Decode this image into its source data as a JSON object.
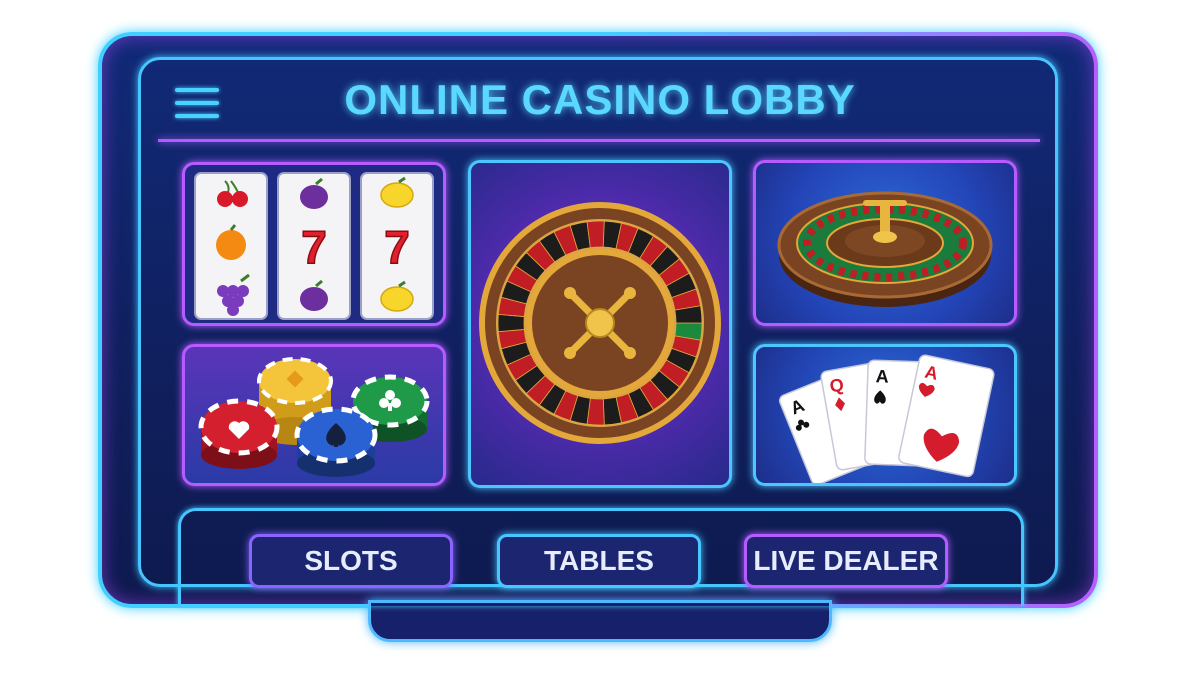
{
  "header": {
    "title": "ONLINE CASINO LOBBY",
    "menu_icon": "hamburger-menu-icon"
  },
  "tiles": [
    {
      "icon": "slot-machine-icon",
      "reel_symbols": [
        "7",
        "7"
      ]
    },
    {
      "icon": "roulette-wheel-icon"
    },
    {
      "icon": "roulette-table-icon"
    },
    {
      "icon": "poker-chips-icon"
    },
    {
      "icon": "playing-cards-icon",
      "cards": [
        "A",
        "Q",
        "A",
        "A"
      ]
    }
  ],
  "nav": {
    "slots_label": "SLOTS",
    "tables_label": "TABLES",
    "live_dealer_label": "LIVE DEALER"
  },
  "colors": {
    "neon_cyan": "#3fd0ff",
    "neon_purple": "#b65bff",
    "panel_navy": "#112a78",
    "title_text": "#5ad8ff"
  }
}
